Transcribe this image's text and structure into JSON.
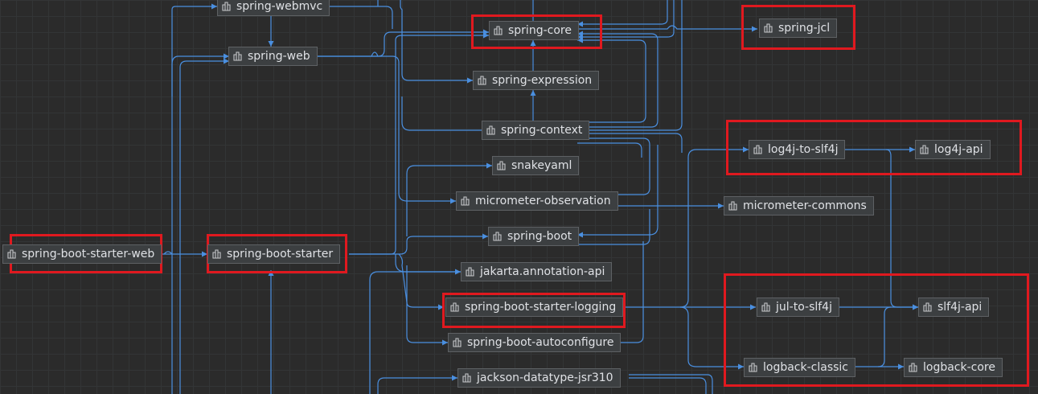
{
  "colors": {
    "background": "#2b2b2b",
    "edge": "#4a8fe0",
    "highlight": "#e0191f",
    "node_fill": "#3c3f41",
    "node_border": "#5e6164",
    "node_text": "#dfe1e5"
  },
  "node_icon": "module-icon",
  "nodes": {
    "spring_webmvc": "spring-webmvc",
    "spring_web": "spring-web",
    "spring_core": "spring-core",
    "spring_jcl": "spring-jcl",
    "spring_expression": "spring-expression",
    "spring_context": "spring-context",
    "snakeyaml": "snakeyaml",
    "micrometer_observation": "micrometer-observation",
    "micrometer_commons": "micrometer-commons",
    "log4j_to_slf4j": "log4j-to-slf4j",
    "log4j_api": "log4j-api",
    "spring_boot_starter_web": "spring-boot-starter-web",
    "spring_boot_starter": "spring-boot-starter",
    "spring_boot": "spring-boot",
    "jakarta_annotation_api": "jakarta.annotation-api",
    "spring_boot_starter_logging": "spring-boot-starter-logging",
    "jul_to_slf4j": "jul-to-slf4j",
    "slf4j_api": "slf4j-api",
    "spring_boot_autoconfigure": "spring-boot-autoconfigure",
    "logback_classic": "logback-classic",
    "logback_core": "logback-core",
    "jackson_datatype_jsr310": "jackson-datatype-jsr310"
  }
}
